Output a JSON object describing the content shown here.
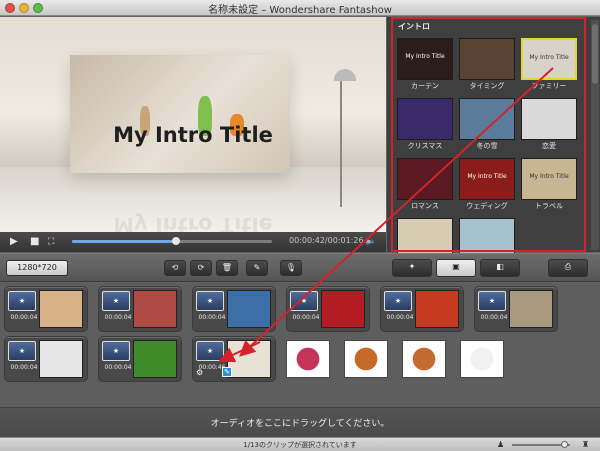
{
  "window": {
    "title": "名称未設定 – Wondershare Fantashow"
  },
  "preview": {
    "title_text": "My Intro Title",
    "timecode": "00:00:42/00:01:26",
    "progress_fraction": 0.52
  },
  "panel": {
    "header": "イントロ",
    "templates": [
      {
        "label": "カーテン",
        "thumb_text": "My Intro Title",
        "bg": "#2a1d1a"
      },
      {
        "label": "タイミング",
        "thumb_text": "",
        "bg": "#5a4333"
      },
      {
        "label": "ファミリー",
        "thumb_text": "My Intro Title",
        "bg": "#d8d3c8",
        "selected": true
      },
      {
        "label": "クリスマス",
        "thumb_text": "",
        "bg": "#3a2a6c"
      },
      {
        "label": "冬の雪",
        "thumb_text": "",
        "bg": "#5a7c9a"
      },
      {
        "label": "恋愛",
        "thumb_text": "",
        "bg": "#d9d9d9"
      },
      {
        "label": "ロマンス",
        "thumb_text": "",
        "bg": "#5b1a22"
      },
      {
        "label": "ウェディング",
        "thumb_text": "My Intro Title",
        "bg": "#8a1c1c"
      },
      {
        "label": "トラベル",
        "thumb_text": "My Intro Title",
        "bg": "#c8b592"
      },
      {
        "label": "",
        "thumb_text": "",
        "bg": "#d8cbb3"
      },
      {
        "label": "",
        "thumb_text": "",
        "bg": "#a6c0cc"
      }
    ]
  },
  "toolbar": {
    "resolution": "1280*720"
  },
  "storyboard": {
    "row1": [
      {
        "time": "00:00:04",
        "color": "#d9b28a"
      },
      {
        "time": "00:00:04",
        "color": "#b04a44"
      },
      {
        "time": "00:00:04",
        "color": "#3c6fa8"
      },
      {
        "time": "00:00:04",
        "color": "#b21c22"
      },
      {
        "time": "00:00:04",
        "color": "#c73a22"
      },
      {
        "time": "00:00:04",
        "color": "#a89a80"
      }
    ],
    "row2": [
      {
        "time": "00:00:04",
        "color": "#e6e6e6"
      },
      {
        "time": "00:00:04",
        "color": "#3f8a2a"
      },
      {
        "time": "00:00:46",
        "color": "#e8e2d4"
      }
    ],
    "loose": [
      {
        "color": "#c43458"
      },
      {
        "color": "#c66a2a"
      },
      {
        "color": "#c76a30"
      },
      {
        "color": "#f1f1f1"
      }
    ],
    "drop_text": "オーディオをここにドラッグしてください。"
  },
  "status": {
    "text": "1/13のクリップが選択されています",
    "zoom_fraction": 0.92
  },
  "colors": {
    "accent_red": "#d4222b",
    "selected_yellow": "#e6d530"
  }
}
